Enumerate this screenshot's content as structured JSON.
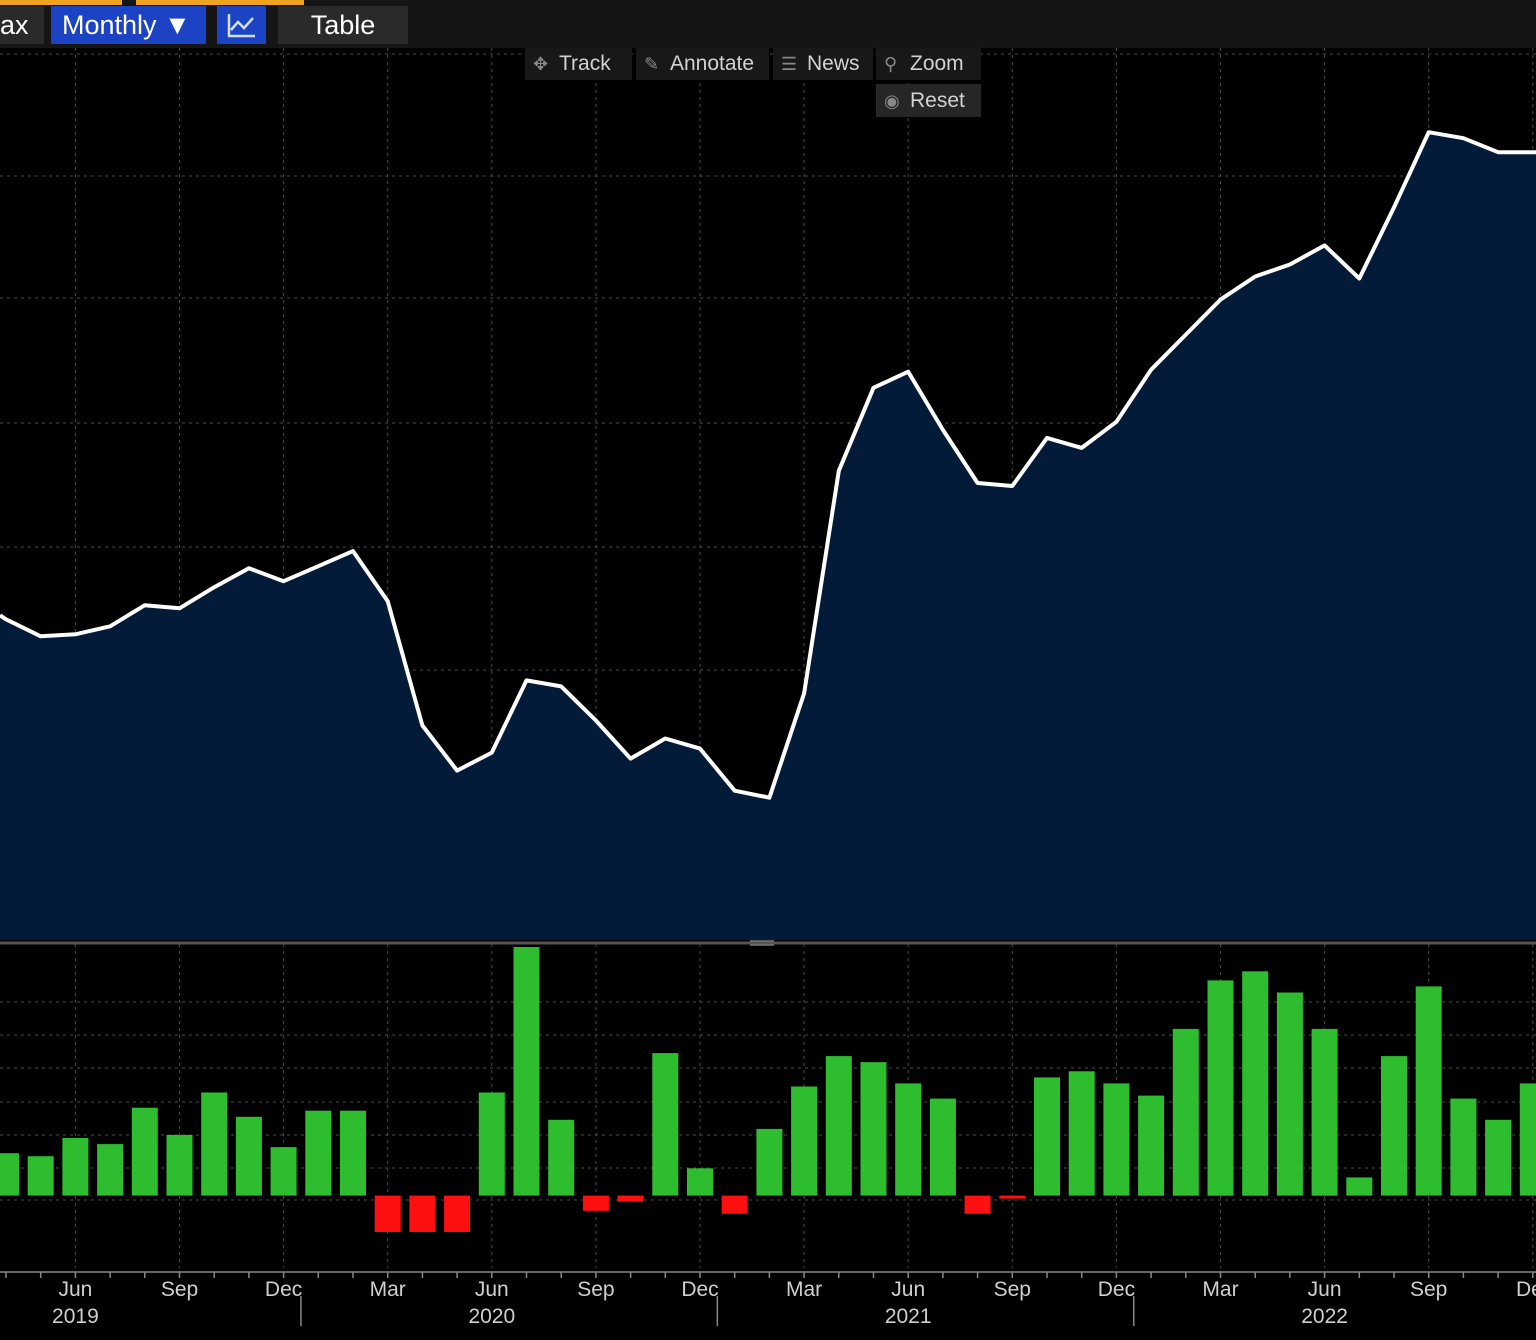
{
  "toolbar": {
    "max_label": "ax",
    "period_label": "Monthly ▼",
    "chart_mode_icon": "line-chart-icon",
    "table_label": "Table",
    "accent_color": "#f0a31f",
    "active_color": "#1b43c4"
  },
  "chart_tools": {
    "track": "Track",
    "annotate": "Annotate",
    "news": "News",
    "zoom": "Zoom",
    "reset": "Reset"
  },
  "colors": {
    "line": "#ffffff",
    "area_fill": "#031a38",
    "positive_bar": "#2ebd2e",
    "negative_bar": "#ff1010",
    "grid": "#4a4a4a",
    "tick_text": "#cfcfcf"
  },
  "chart_data": [
    {
      "type": "area",
      "x_unit": "month",
      "x": [
        "2019-04",
        "2019-05",
        "2019-06",
        "2019-07",
        "2019-08",
        "2019-09",
        "2019-10",
        "2019-11",
        "2019-12",
        "2020-01",
        "2020-02",
        "2020-03",
        "2020-04",
        "2020-05",
        "2020-06",
        "2020-07",
        "2020-08",
        "2020-09",
        "2020-10",
        "2020-11",
        "2020-12",
        "2021-01",
        "2021-02",
        "2021-03",
        "2021-04",
        "2021-05",
        "2021-06",
        "2021-07",
        "2021-08",
        "2021-09",
        "2021-10",
        "2021-11",
        "2021-12",
        "2022-01",
        "2022-02",
        "2022-03",
        "2022-04",
        "2022-05",
        "2022-06",
        "2022-07",
        "2022-08",
        "2022-09",
        "2022-10",
        "2022-11",
        "2022-12"
      ],
      "values": [
        34.0,
        32.3,
        32.5,
        33.3,
        35.4,
        35.1,
        37.2,
        39.1,
        37.8,
        39.3,
        40.8,
        35.8,
        23.4,
        18.9,
        20.7,
        27.9,
        27.3,
        23.9,
        20.1,
        22.1,
        21.1,
        16.9,
        16.2,
        26.6,
        48.8,
        57.1,
        58.7,
        52.9,
        47.6,
        47.3,
        52.1,
        51.1,
        53.7,
        58.9,
        62.4,
        65.9,
        68.2,
        69.4,
        71.3,
        68.0,
        75.1,
        82.6,
        82.0,
        80.6,
        80.6
      ],
      "xlim": [
        "2019-03-24",
        "2022-12-31"
      ],
      "ylim": [
        2,
        91
      ],
      "grid": true,
      "x_ticks": [
        {
          "label": "Jun",
          "at": "2019-06"
        },
        {
          "label": "Sep",
          "at": "2019-09"
        },
        {
          "label": "Dec",
          "at": "2019-12"
        },
        {
          "label": "Mar",
          "at": "2020-03"
        },
        {
          "label": "Jun",
          "at": "2020-06"
        },
        {
          "label": "Sep",
          "at": "2020-09"
        },
        {
          "label": "Dec",
          "at": "2020-12"
        },
        {
          "label": "Mar",
          "at": "2021-03"
        },
        {
          "label": "Jun",
          "at": "2021-06"
        },
        {
          "label": "Sep",
          "at": "2021-09"
        },
        {
          "label": "Dec",
          "at": "2021-12"
        },
        {
          "label": "Mar",
          "at": "2022-03"
        },
        {
          "label": "Jun",
          "at": "2022-06"
        },
        {
          "label": "Sep",
          "at": "2022-09"
        },
        {
          "label": "De",
          "at": "2022-12"
        }
      ],
      "year_labels": [
        {
          "label": "2019",
          "at": "2019-06"
        },
        {
          "label": "2020",
          "at": "2020-06"
        },
        {
          "label": "2021",
          "at": "2021-06"
        },
        {
          "label": "2022",
          "at": "2022-06"
        }
      ]
    },
    {
      "type": "bar",
      "x": [
        "2019-04",
        "2019-05",
        "2019-06",
        "2019-07",
        "2019-08",
        "2019-09",
        "2019-10",
        "2019-11",
        "2019-12",
        "2020-01",
        "2020-02",
        "2020-03",
        "2020-04",
        "2020-05",
        "2020-06",
        "2020-07",
        "2020-08",
        "2020-09",
        "2020-10",
        "2020-11",
        "2020-12",
        "2021-01",
        "2021-02",
        "2021-03",
        "2021-04",
        "2021-05",
        "2021-06",
        "2021-07",
        "2021-08",
        "2021-09",
        "2021-10",
        "2021-11",
        "2021-12",
        "2022-01",
        "2022-02",
        "2022-03",
        "2022-04",
        "2022-05",
        "2022-06",
        "2022-07",
        "2022-08",
        "2022-09",
        "2022-10",
        "2022-11",
        "2022-12"
      ],
      "values": [
        14,
        13,
        19,
        17,
        29,
        20,
        34,
        26,
        16,
        28,
        28,
        -12,
        -12,
        -12,
        34,
        82,
        25,
        -5,
        -2,
        47,
        9,
        -6,
        22,
        36,
        46,
        44,
        37,
        32,
        -6,
        -1,
        39,
        41,
        37,
        33,
        55,
        71,
        74,
        67,
        55,
        6,
        46,
        69,
        32,
        25,
        37
      ],
      "ylim": [
        -12,
        82
      ],
      "grid": true
    }
  ]
}
